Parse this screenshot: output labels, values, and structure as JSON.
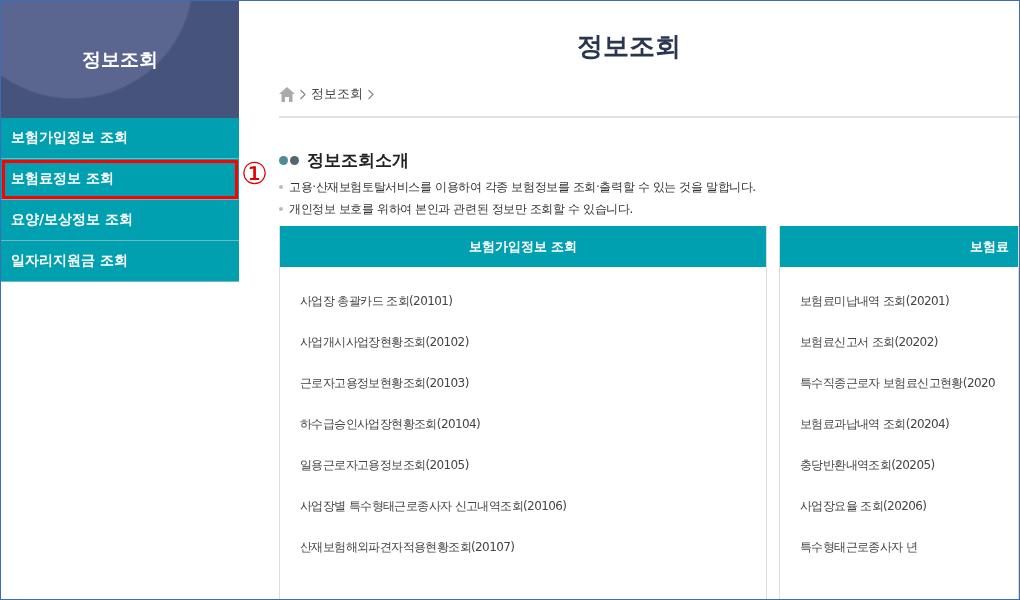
{
  "sidebar": {
    "title": "정보조회",
    "items": [
      {
        "label": "보험가입정보 조회",
        "selected": false,
        "highlighted": false
      },
      {
        "label": "보험료정보 조회",
        "selected": false,
        "highlighted": true
      },
      {
        "label": "요양/보상정보 조회",
        "selected": false,
        "highlighted": false
      },
      {
        "label": "일자리지원금 조회",
        "selected": false,
        "highlighted": false
      }
    ]
  },
  "annotation": "①",
  "page_title": "정보조회",
  "breadcrumb": [
    "정보조회"
  ],
  "section": {
    "title": "정보조회소개",
    "bullets": [
      "고용·산재보험토탈서비스를 이용하여 각종 보험정보를 조회·출력할 수 있는 것을 말합니다.",
      "개인정보 보호를 위하여 본인과 관련된 정보만 조회할 수 있습니다."
    ]
  },
  "cards": [
    {
      "title": "보험가입정보 조회",
      "links": [
        "사업장 총괄카드 조회(20101)",
        "사업개시사업장현황조회(20102)",
        "근로자고용정보현황조회(20103)",
        "하수급승인사업장현황조회(20104)",
        "일용근로자고용정보조회(20105)",
        "사업장별 특수형태근로종사자 신고내역조회(20106)",
        "산재보험해외파견자적용현황조회(20107)"
      ]
    },
    {
      "title": "보험료",
      "links": [
        "보험료미납내역 조회(20201)",
        "보험료신고서 조회(20202)",
        "특수직종근로자 보험료신고현황(2020",
        "보험료과납내역 조회(20204)",
        "충당반환내역조회(20205)",
        "사업장요율 조회(20206)",
        "특수형태근로종사자 년"
      ]
    }
  ]
}
